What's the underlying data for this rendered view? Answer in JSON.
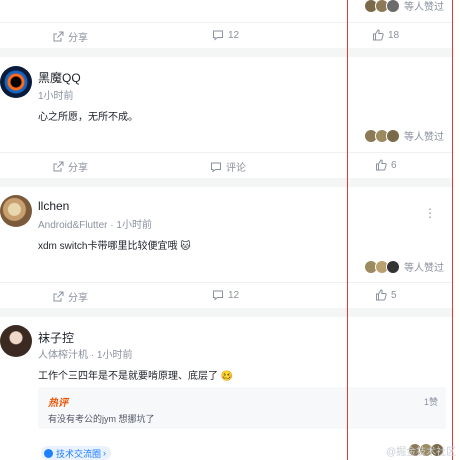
{
  "feed": {
    "liked_suffix": "等人赞过",
    "share_label": "分享",
    "comment_label_text": "评论",
    "posts": [
      {
        "comment_count": "12",
        "like_count": "18"
      },
      {
        "author": "黑魔QQ",
        "time": "1小时前",
        "content": "心之所愿，无所不成。",
        "comment_label": "评论",
        "like_count": "6"
      },
      {
        "author": "llchen",
        "title": "Android&Flutter",
        "time": "1小时前",
        "content": "xdm switch卡带哪里比较便宜哦 🐱",
        "comment_count": "12",
        "like_count": "5"
      },
      {
        "author": "袜子控",
        "title": "人体榨汁机",
        "time": "1小时前",
        "content": "工作个三四年是不是就要啃原理、底层了 🥴",
        "hot_comment": {
          "label": "热评",
          "text": "有没有考公的jym 想挪坑了",
          "likes": "1赞"
        },
        "topic": "技术交流圈"
      }
    ]
  },
  "separator": "·",
  "watermark": "@掘金技术社区",
  "colors": {
    "accent": "#1e80ff",
    "highlight_box": "#e53935",
    "hot_label": "#e8580c"
  },
  "icons": [
    "share-icon",
    "comment-icon",
    "like-icon",
    "more-icon",
    "topic-icon"
  ]
}
